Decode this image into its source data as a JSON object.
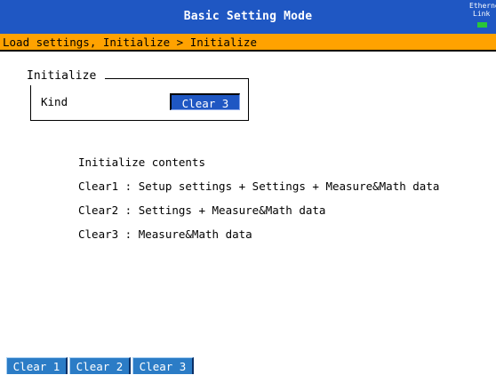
{
  "header": {
    "title": "Basic Setting Mode",
    "ethernet_line1": "Etherne",
    "ethernet_line2": "Link",
    "ethernet_led_color": "#29c63a"
  },
  "breadcrumb": "Load settings, Initialize > Initialize",
  "initialize_group": {
    "title": "Initialize",
    "kind_label": "Kind",
    "kind_value": "Clear 3"
  },
  "contents": {
    "heading": "Initialize contents",
    "lines": [
      "Clear1 : Setup settings + Settings + Measure&Math data",
      "Clear2 : Settings + Measure&Math data",
      "Clear3 : Measure&Math data"
    ]
  },
  "softkeys": [
    {
      "label": "Clear 1"
    },
    {
      "label": "Clear 2"
    },
    {
      "label": "Clear 3"
    }
  ],
  "colors": {
    "titlebar": "#1f57c3",
    "breadcrumb_bar": "#ffa200",
    "selected_value": "#1f57c3",
    "softkey": "#2b7cc6"
  }
}
